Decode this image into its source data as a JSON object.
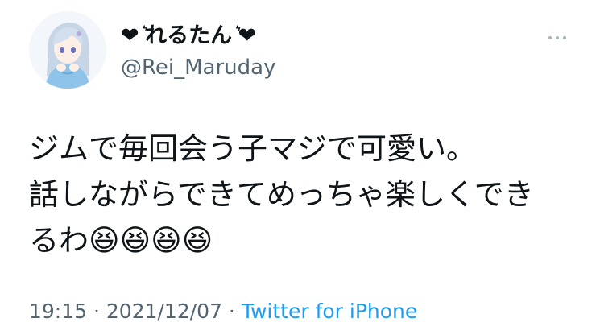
{
  "user": {
    "display_name": "❤︎ ͛れるたん ͛❤︎",
    "handle": "@Rei_Maruday"
  },
  "tweet": {
    "line1": "ジムで毎回会う子マジで可愛い。",
    "line2": "話しながらできてめっちゃ楽しくでき",
    "line3": "るわ😆😆😆😆",
    "time": "19:15",
    "separator1": " · ",
    "date": "2021/12/07",
    "separator2": " · ",
    "source": "Twitter for iPhone"
  },
  "icons": {
    "more": "more-horizontal-icon",
    "avatar": "anime-avatar"
  },
  "colors": {
    "text": "#0f1419",
    "secondary": "#536471",
    "link": "#1d9bf0"
  }
}
